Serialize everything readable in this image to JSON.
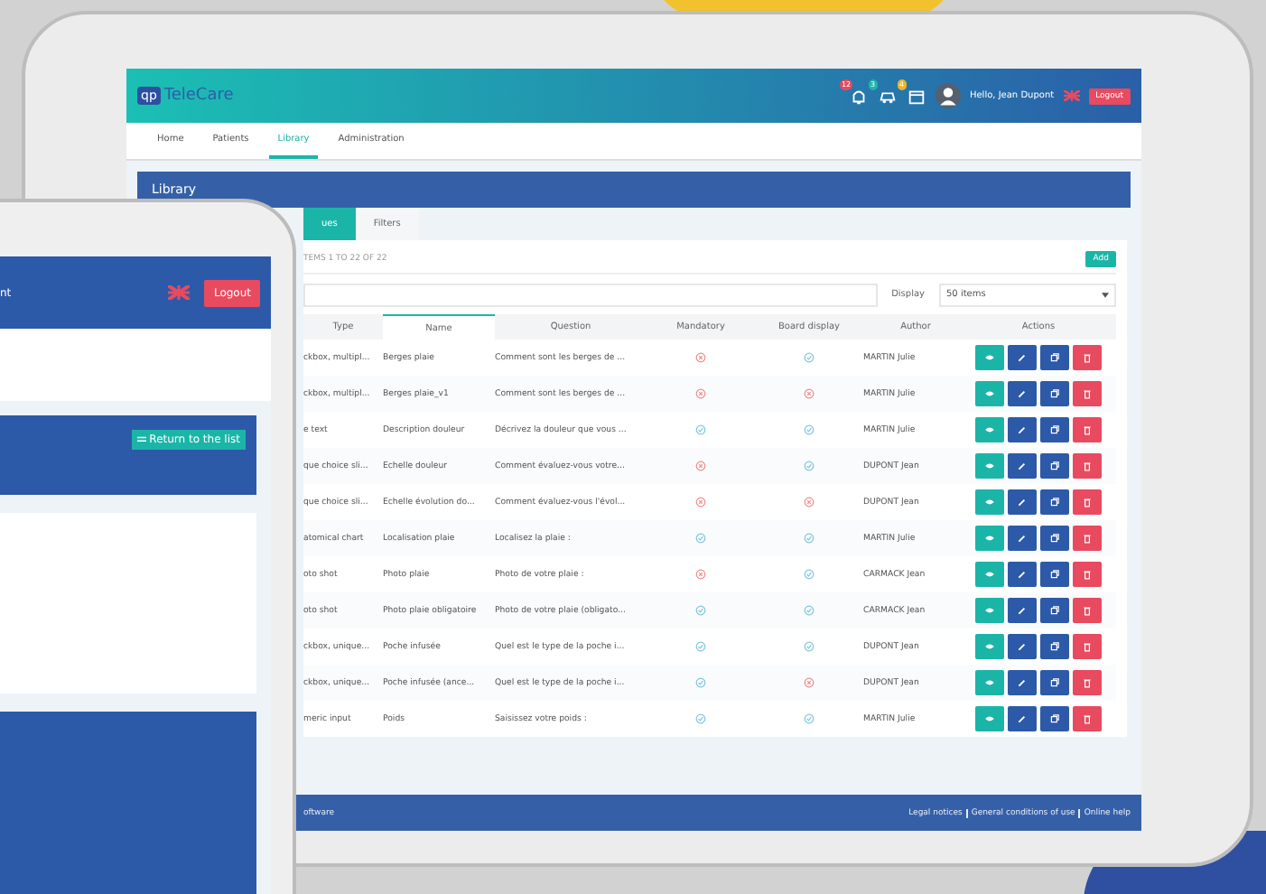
{
  "back_screen": {
    "app_name": "TeleCare",
    "logo_text": "qp",
    "notifications": [
      {
        "count": "12",
        "color": "#e84a5f"
      },
      {
        "count": "3",
        "color": "#1fb5a8"
      },
      {
        "count": "4",
        "color": "#f0b429"
      }
    ],
    "greeting": "Hello, Jean Dupont",
    "logout": "Logout",
    "nav": [
      {
        "label": "Home",
        "selected": false
      },
      {
        "label": "Patients",
        "selected": false
      },
      {
        "label": "Library",
        "selected": true
      },
      {
        "label": "Administration",
        "selected": false
      }
    ],
    "panel_title": "Library",
    "tabs": [
      {
        "label": "ues",
        "selected": true
      },
      {
        "label": "Filters",
        "selected": false
      }
    ],
    "items_count": "TEMS 1 TO 22 OF 22",
    "add_button": "Add",
    "display_label": "Display",
    "display_value": "50 items",
    "table": {
      "columns": [
        "Type",
        "Name",
        "Question",
        "Mandatory",
        "Board display",
        "Author",
        "Actions"
      ],
      "rows": [
        {
          "type": "ckbox, multipl...",
          "name": "Berges plaie",
          "question": "Comment sont les berges de ...",
          "mandatory": false,
          "board_display": true,
          "author": "MARTIN Julie"
        },
        {
          "type": "ckbox, multipl...",
          "name": "Berges plaie_v1",
          "question": "Comment sont les berges de ...",
          "mandatory": false,
          "board_display": false,
          "author": "MARTIN Julie"
        },
        {
          "type": "e text",
          "name": "Description douleur",
          "question": "Décrivez la douleur que vous ...",
          "mandatory": true,
          "board_display": true,
          "author": "MARTIN Julie"
        },
        {
          "type": "que choice sli...",
          "name": "Echelle douleur",
          "question": "Comment évaluez-vous votre...",
          "mandatory": false,
          "board_display": true,
          "author": "DUPONT Jean"
        },
        {
          "type": "que choice sli...",
          "name": "Echelle évolution do...",
          "question": "Comment évaluez-vous l'évol...",
          "mandatory": false,
          "board_display": false,
          "author": "DUPONT Jean"
        },
        {
          "type": "atomical chart",
          "name": "Localisation plaie",
          "question": "Localisez la plaie :",
          "mandatory": true,
          "board_display": true,
          "author": "MARTIN Julie"
        },
        {
          "type": "oto shot",
          "name": "Photo plaie",
          "question": "Photo de votre plaie :",
          "mandatory": false,
          "board_display": true,
          "author": "CARMACK Jean"
        },
        {
          "type": "oto shot",
          "name": "Photo plaie obligatoire",
          "question": "Photo de votre plaie (obligato...",
          "mandatory": true,
          "board_display": true,
          "author": "CARMACK Jean"
        },
        {
          "type": "ckbox, unique...",
          "name": "Poche infusée",
          "question": "Quel est le type de la poche i...",
          "mandatory": true,
          "board_display": true,
          "author": "DUPONT Jean"
        },
        {
          "type": "ckbox, unique...",
          "name": "Poche infusée (ance...",
          "question": "Quel est le type de la poche i...",
          "mandatory": true,
          "board_display": false,
          "author": "DUPONT Jean"
        },
        {
          "type": "meric input",
          "name": "Poids",
          "question": "Saisissez votre poids :",
          "mandatory": true,
          "board_display": true,
          "author": "MARTIN Julie"
        }
      ]
    },
    "footer_left": "oftware",
    "footer_links": [
      "Legal notices",
      "General conditions of use",
      "Online help"
    ]
  },
  "front_screen": {
    "greeting": "nt",
    "logout": "Logout",
    "return_button": "Return to the list"
  }
}
